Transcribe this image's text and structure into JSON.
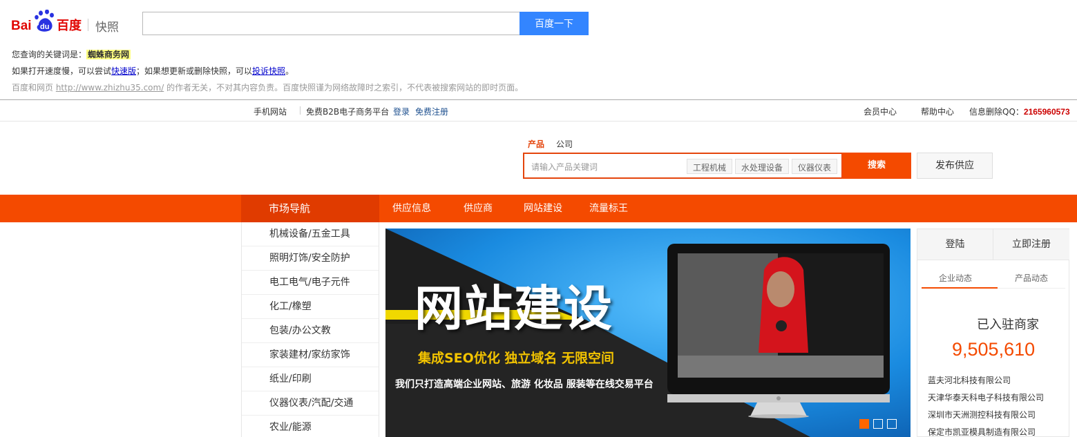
{
  "baidu": {
    "logo_text": "Bai百度",
    "logo_du": "du",
    "kuaizhao": "快照",
    "search_value": "",
    "search_button": "百度一下",
    "keyword_prefix": "您查询的关键词是：",
    "keyword": "蜘蛛商务网",
    "line2_a": "如果打开速度慢，可以尝试",
    "line2_link1": "快速版",
    "line2_b": "；如果想更新或删除快照，可以",
    "line2_link2": "投诉快照",
    "line2_c": "。",
    "line3_a": "百度和网页 ",
    "line3_url": "http://www.zhizhu35.com/",
    "line3_b": " 的作者无关，不对其内容负责。百度快照谨为网络故障时之索引，不代表被搜索网站的即时页面。"
  },
  "topbar": {
    "mobile": "手机网站",
    "free_platform": "免费B2B电子商务平台",
    "login": "登录",
    "register": "免费注册",
    "member_center": "会员中心",
    "help_center": "帮助中心",
    "delete_info": "信息删除QQ：",
    "qq": "2165960573"
  },
  "search": {
    "tab_product": "产品",
    "tab_company": "公司",
    "placeholder": "请输入产品关键词",
    "tags": [
      "工程机械",
      "水处理设备",
      "仪器仪表"
    ],
    "button": "搜索",
    "publish": "发布供应"
  },
  "nav": {
    "market": "市场导航",
    "items": [
      "供应信息",
      "供应商",
      "网站建设",
      "流量标王"
    ]
  },
  "categories": [
    "机械设备/五金工具",
    "照明灯饰/安全防护",
    "电工电气/电子元件",
    "化工/橡塑",
    "包装/办公文教",
    "家装建材/家纺家饰",
    "纸业/印刷",
    "仪器仪表/汽配/交通",
    "农业/能源"
  ],
  "banner": {
    "title": "网站建设",
    "subtitle": "集成SEO优化 独立域名 无限空间",
    "tagline": "我们只打造高端企业网站、旅游 化妆品 服装等在线交易平台"
  },
  "right_panel": {
    "login": "登陆",
    "register": "立即注册",
    "tab_company_news": "企业动态",
    "tab_product_news": "产品动态",
    "joined_label": "已入驻商家",
    "joined_count": "9,505,610",
    "companies": [
      "蓝夫河北科技有限公司",
      "天津华泰天科电子科技有限公司",
      "深圳市天洲测控科技有限公司",
      "保定市凯亚模具制造有限公司"
    ]
  }
}
